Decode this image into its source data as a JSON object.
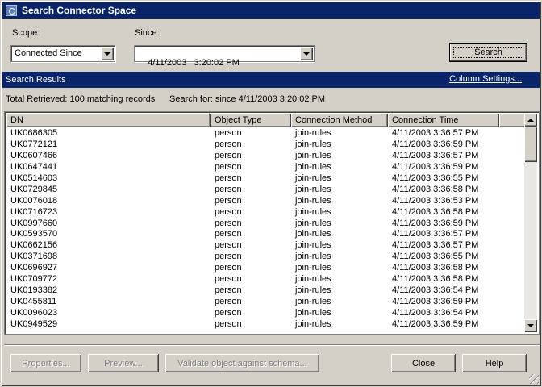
{
  "window": {
    "title": "Search Connector Space"
  },
  "scope": {
    "label": "Scope:",
    "value": "Connected Since"
  },
  "since": {
    "label": "Since:",
    "value": "4/11/2003   3:20:02 PM"
  },
  "search_button": "Search",
  "results": {
    "title": "Search Results",
    "column_settings": "Column Settings...",
    "total": "Total Retrieved:  100 matching records",
    "search_for": "Search for:  since 4/11/2003 3:20:02 PM",
    "columns": [
      "DN",
      "Object Type",
      "Connection Method",
      "Connection Time",
      ""
    ],
    "rows": [
      [
        "UK0686305",
        "person",
        "join-rules",
        "4/11/2003 3:36:57 PM"
      ],
      [
        "UK0772121",
        "person",
        "join-rules",
        "4/11/2003 3:36:59 PM"
      ],
      [
        "UK0607466",
        "person",
        "join-rules",
        "4/11/2003 3:36:57 PM"
      ],
      [
        "UK0647441",
        "person",
        "join-rules",
        "4/11/2003 3:36:59 PM"
      ],
      [
        "UK0514603",
        "person",
        "join-rules",
        "4/11/2003 3:36:55 PM"
      ],
      [
        "UK0729845",
        "person",
        "join-rules",
        "4/11/2003 3:36:58 PM"
      ],
      [
        "UK0076018",
        "person",
        "join-rules",
        "4/11/2003 3:36:53 PM"
      ],
      [
        "UK0716723",
        "person",
        "join-rules",
        "4/11/2003 3:36:58 PM"
      ],
      [
        "UK0997660",
        "person",
        "join-rules",
        "4/11/2003 3:36:59 PM"
      ],
      [
        "UK0593570",
        "person",
        "join-rules",
        "4/11/2003 3:36:57 PM"
      ],
      [
        "UK0662156",
        "person",
        "join-rules",
        "4/11/2003 3:36:57 PM"
      ],
      [
        "UK0371698",
        "person",
        "join-rules",
        "4/11/2003 3:36:55 PM"
      ],
      [
        "UK0696927",
        "person",
        "join-rules",
        "4/11/2003 3:36:58 PM"
      ],
      [
        "UK0709772",
        "person",
        "join-rules",
        "4/11/2003 3:36:58 PM"
      ],
      [
        "UK0193382",
        "person",
        "join-rules",
        "4/11/2003 3:36:54 PM"
      ],
      [
        "UK0455811",
        "person",
        "join-rules",
        "4/11/2003 3:36:59 PM"
      ],
      [
        "UK0096023",
        "person",
        "join-rules",
        "4/11/2003 3:36:54 PM"
      ],
      [
        "UK0949529",
        "person",
        "join-rules",
        "4/11/2003 3:36:59 PM"
      ]
    ]
  },
  "footer": {
    "properties": "Properties...",
    "preview": "Preview...",
    "validate": "Validate object against schema...",
    "close": "Close",
    "help": "Help"
  },
  "icons": {
    "title": "connector-space-icon",
    "combo_arrow": "chevron-down-icon",
    "scroll_up": "arrow-up-icon",
    "scroll_down": "arrow-down-icon",
    "grip": "resize-grip-icon"
  },
  "colors": {
    "titlebar": "#0a246a",
    "face": "#d4d0c8"
  }
}
